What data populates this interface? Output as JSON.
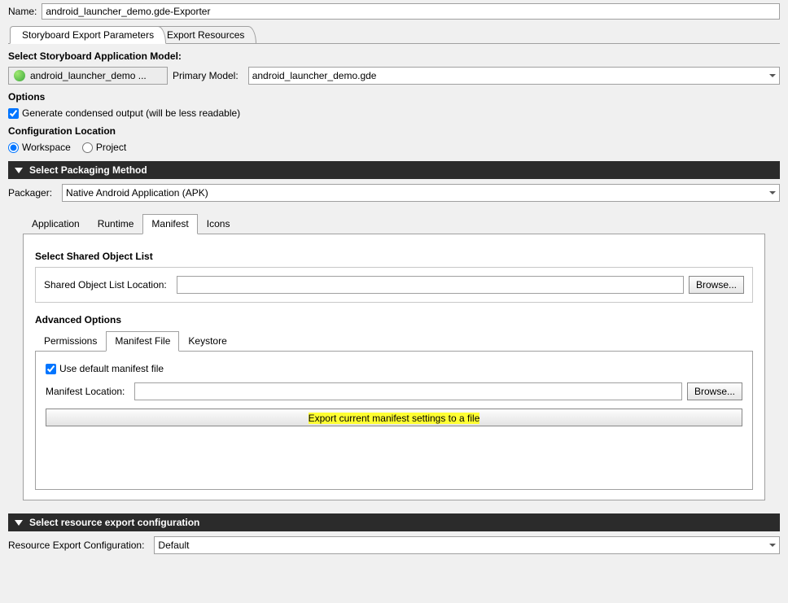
{
  "header": {
    "name_label": "Name:",
    "name_value": "android_launcher_demo.gde-Exporter"
  },
  "top_tabs": {
    "params": "Storyboard Export Parameters",
    "resources": "Export Resources"
  },
  "model": {
    "title": "Select Storyboard Application Model:",
    "button_text": "android_launcher_demo ...",
    "primary_label": "Primary Model:",
    "primary_value": "android_launcher_demo.gde"
  },
  "options": {
    "title": "Options",
    "condensed_label": "Generate condensed output (will be less readable)",
    "condensed_checked": true
  },
  "config_loc": {
    "title": "Configuration Location",
    "workspace": "Workspace",
    "project": "Project",
    "selected": "workspace"
  },
  "packaging": {
    "bar": "Select Packaging Method",
    "packager_label": "Packager:",
    "packager_value": "Native Android Application (APK)"
  },
  "pkg_tabs": {
    "application": "Application",
    "runtime": "Runtime",
    "manifest": "Manifest",
    "icons": "Icons",
    "active": "manifest"
  },
  "shared_obj": {
    "title": "Select Shared Object List",
    "label": "Shared Object List Location:",
    "value": "",
    "browse": "Browse..."
  },
  "advanced": {
    "title": "Advanced Options",
    "tabs": {
      "permissions": "Permissions",
      "manifest_file": "Manifest File",
      "keystore": "Keystore",
      "active": "manifest_file"
    }
  },
  "manifest_file": {
    "use_default_label": "Use default manifest file",
    "use_default_checked": true,
    "location_label": "Manifest Location:",
    "location_value": "",
    "browse": "Browse...",
    "export_button": "Export current manifest settings to a file"
  },
  "resource_export": {
    "bar": "Select resource export configuration",
    "label": "Resource Export Configuration:",
    "value": "Default"
  }
}
